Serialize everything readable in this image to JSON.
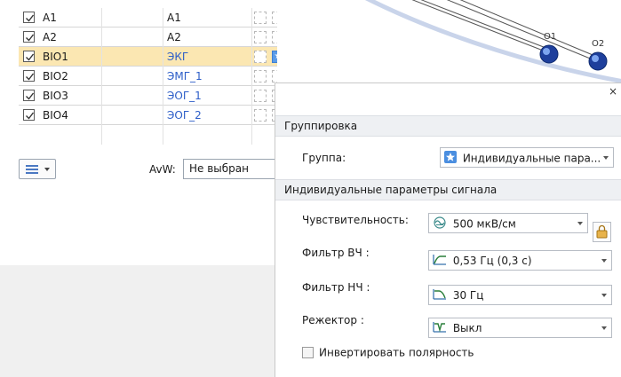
{
  "channels": [
    {
      "name": "A1",
      "label": "A1",
      "checked": true,
      "label_color": "default",
      "starred": false,
      "selected": false
    },
    {
      "name": "A2",
      "label": "A2",
      "checked": true,
      "label_color": "default",
      "starred": false,
      "selected": false
    },
    {
      "name": "BIO1",
      "label": "ЭКГ",
      "checked": true,
      "label_color": "#2d5ec8",
      "starred": true,
      "selected": true
    },
    {
      "name": "BIO2",
      "label": "ЭМГ_1",
      "checked": true,
      "label_color": "#2d5ec8",
      "starred": false,
      "selected": false
    },
    {
      "name": "BIO3",
      "label": "ЭОГ_1",
      "checked": true,
      "label_color": "#2d5ec8",
      "starred": false,
      "selected": false
    },
    {
      "name": "BIO4",
      "label": "ЭОГ_2",
      "checked": true,
      "label_color": "#2d5ec8",
      "starred": false,
      "selected": false
    }
  ],
  "bottom_bar": {
    "avw_label": "AvW:",
    "avw_value": "Не выбран"
  },
  "electrodes": [
    {
      "label": "O1"
    },
    {
      "label": "O2"
    }
  ],
  "properties": {
    "close_label": "×",
    "grouping_header": "Группировка",
    "group_label": "Группа:",
    "group_value": "Индивидуальные пара...",
    "individual_header": "Индивидуальные параметры сигнала",
    "sensitivity_label": "Чувствительность:",
    "sensitivity_value": "500 мкВ/см",
    "hpf_label": "Фильтр ВЧ :",
    "hpf_value": "0,53 Гц (0,3 с)",
    "lpf_label": "Фильтр НЧ :",
    "lpf_value": "30 Гц",
    "notch_label": "Режектор :",
    "notch_value": "Выкл",
    "invert_label": "Инвертировать полярность",
    "invert_checked": false
  },
  "colors": {
    "selected_row": "#fbe7b2",
    "accent_blue": "#2d5ec8",
    "star_blue": "#5a9be8"
  }
}
